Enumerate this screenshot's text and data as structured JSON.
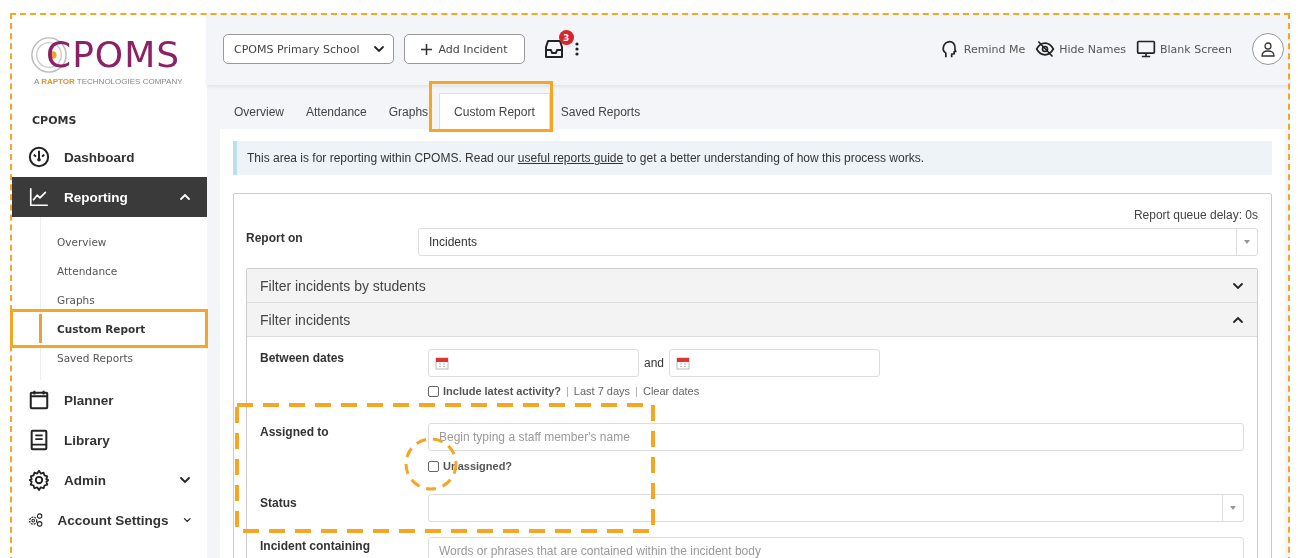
{
  "sidebar": {
    "logo": {
      "text": "CPOMS",
      "tagline": "A **RAPTOR** TECHNOLOGIES COMPANY"
    },
    "section": "CPOMS",
    "items": [
      {
        "kind": "plain",
        "label": "Dashboard",
        "selected": false
      },
      {
        "kind": "group",
        "label": "Reporting",
        "selected": true,
        "expanded": true,
        "children": [
          {
            "label": "Overview",
            "selected": false
          },
          {
            "label": "Attendance",
            "selected": false
          },
          {
            "label": "Graphs",
            "selected": false
          },
          {
            "label": "Custom Report",
            "selected": true
          },
          {
            "label": "Saved Reports",
            "selected": false
          }
        ]
      },
      {
        "kind": "plain",
        "label": "Planner",
        "selected": false
      },
      {
        "kind": "plain",
        "label": "Library",
        "selected": false
      },
      {
        "kind": "group",
        "label": "Admin",
        "selected": false,
        "expanded": false
      },
      {
        "kind": "group",
        "label": "Account Settings",
        "selected": false,
        "expanded": false
      }
    ]
  },
  "topbar": {
    "school": "CPOMS Primary School",
    "add_button": "Add Incident",
    "inbox_badge": "3",
    "actions": [
      {
        "label": "Remind Me"
      },
      {
        "label": "Hide Names"
      },
      {
        "label": "Blank Screen"
      }
    ]
  },
  "tabs": [
    {
      "label": "Overview",
      "selected": false
    },
    {
      "label": "Attendance",
      "selected": false
    },
    {
      "label": "Graphs",
      "selected": false
    },
    {
      "label": "Custom Report",
      "selected": true
    },
    {
      "label": "Saved Reports",
      "selected": false
    }
  ],
  "alert": {
    "before": "This area is for reporting within CPOMS. Read our ",
    "link": "useful reports guide",
    "after": " to get a better understanding of how this process works."
  },
  "report": {
    "queue_delay": "Report queue delay: 0s",
    "report_on_label": "Report on",
    "report_on_value": "Incidents",
    "panels": [
      {
        "title": "Filter incidents by students",
        "expanded": false
      },
      {
        "title": "Filter incidents",
        "expanded": true
      }
    ],
    "between_dates": {
      "label": "Between dates",
      "joiner": "and",
      "checkbox": {
        "label": "Include latest activity?",
        "checked": false
      },
      "extras": [
        {
          "kind": "sep",
          "text": "|"
        },
        {
          "kind": "link",
          "text": "Last 7 days"
        },
        {
          "kind": "sep",
          "text": "|"
        },
        {
          "kind": "link",
          "text": "Clear dates"
        }
      ]
    },
    "assigned_to": {
      "label": "Assigned to",
      "placeholder": "Begin typing a staff member's name",
      "checkbox": {
        "label": "Unassigned?",
        "checked": false
      }
    },
    "status": {
      "label": "Status"
    },
    "incident_containing": {
      "label": "Incident containing",
      "placeholder": "Words or phrases that are contained within the incident body"
    }
  }
}
